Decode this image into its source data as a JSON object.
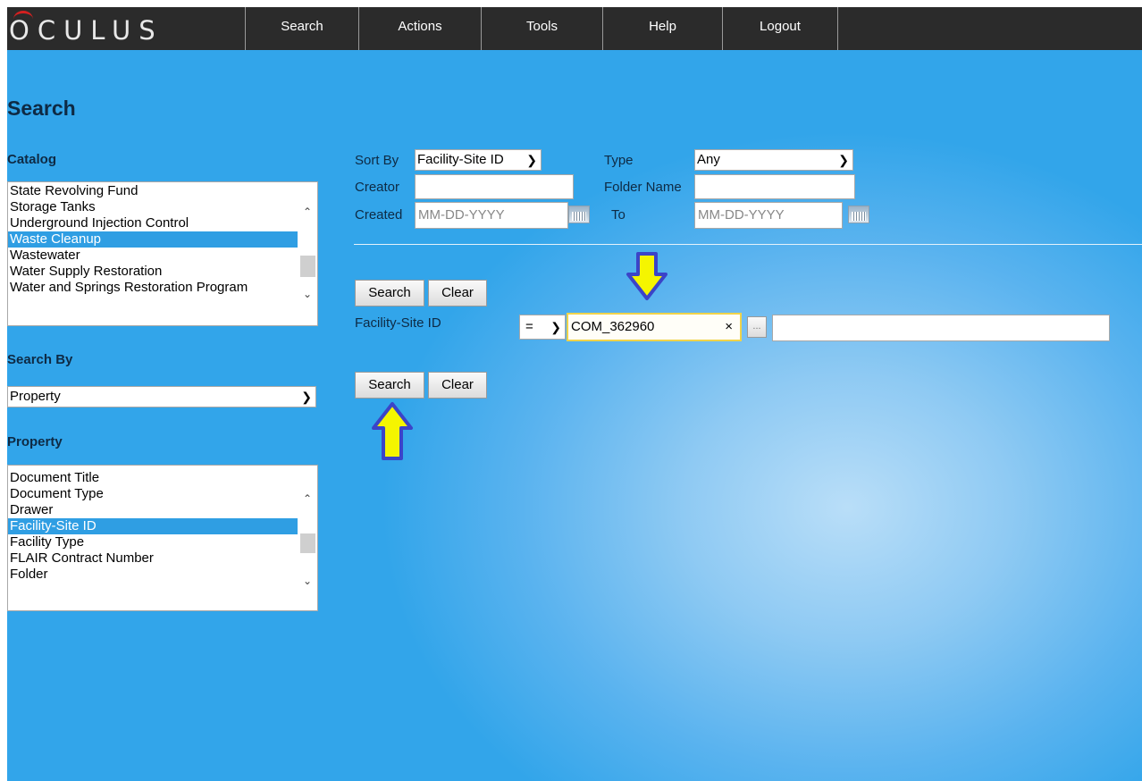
{
  "app": {
    "logo": "OCULUS"
  },
  "nav": {
    "items": [
      "Search",
      "Actions",
      "Tools",
      "Help",
      "Logout"
    ]
  },
  "page": {
    "title": "Search"
  },
  "catalog": {
    "label": "Catalog",
    "items": [
      "State Revolving Fund",
      "Storage Tanks",
      "Underground Injection Control",
      "Waste Cleanup",
      "Wastewater",
      "Water Supply Restoration",
      "Water and Springs Restoration Program"
    ],
    "selected": "Waste Cleanup"
  },
  "search_by": {
    "label": "Search By",
    "value": "Property"
  },
  "property": {
    "label": "Property",
    "items": [
      "Document Title",
      "Document Type",
      "Drawer",
      "Facility-Site ID",
      "Facility Type",
      "FLAIR Contract Number",
      "Folder"
    ],
    "selected": "Facility-Site ID"
  },
  "form": {
    "sort_by_label": "Sort By",
    "sort_by_value": "Facility-Site ID",
    "type_label": "Type",
    "type_value": "Any",
    "creator_label": "Creator",
    "creator_value": "",
    "folder_name_label": "Folder Name",
    "folder_name_value": "",
    "created_label": "Created",
    "created_placeholder": "MM-DD-YYYY",
    "to_label": "To",
    "to_placeholder": "MM-DD-YYYY",
    "search_label": "Search",
    "clear_label": "Clear",
    "criteria_label": "Facility-Site ID",
    "operator": "=",
    "criteria_value": "COM_362960",
    "clear_x": "×",
    "browse": "...",
    "criteria_value2": ""
  },
  "colors": {
    "background": "#32a5ea",
    "topbar": "#2b2b2b",
    "selection": "#2f9ee3",
    "highlight_arrow": "#f5f500",
    "arrow_outline": "#3b44c8"
  },
  "icons": [
    "calendar-icon",
    "chevron-down-icon",
    "scroll-up-icon",
    "scroll-down-icon",
    "arrow-down-highlight",
    "arrow-up-highlight"
  ]
}
